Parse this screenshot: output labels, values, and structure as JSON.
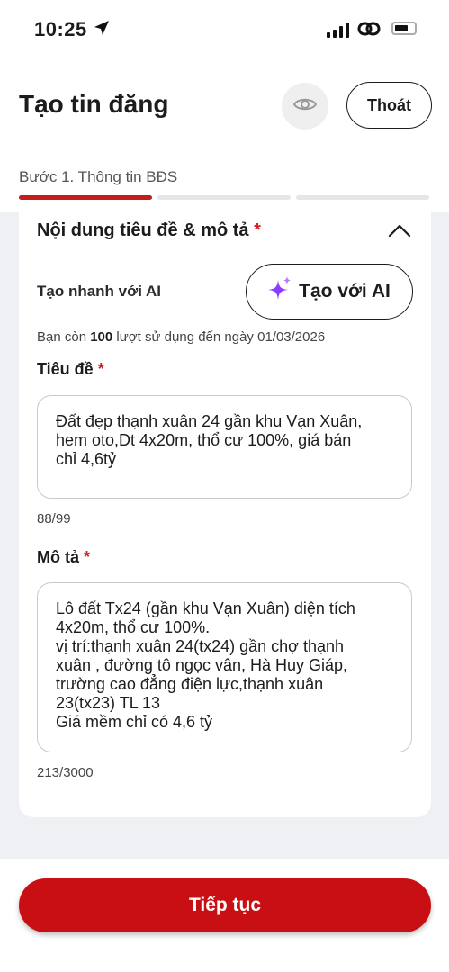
{
  "status_bar": {
    "time": "10:25"
  },
  "header": {
    "title": "Tạo tin đăng",
    "exit_label": "Thoát"
  },
  "stepper": {
    "label": "Bước 1. Thông tin BĐS",
    "total_steps": 3,
    "current_step": 1
  },
  "section": {
    "title": "Nội dung tiêu đề & mô tả",
    "required_mark": "*",
    "ai_label": "Tạo nhanh với AI",
    "ai_button": "Tạo với AI",
    "usage_prefix": "Bạn còn ",
    "usage_count": "100",
    "usage_suffix": " lượt sử dụng đến ngày 01/03/2026"
  },
  "title_field": {
    "label": "Tiêu đề",
    "value": "Đất đẹp thạnh xuân 24 gần khu Vạn Xuân,\nhem oto,Dt 4x20m, thổ cư 100%, giá bán\nchỉ 4,6tỷ",
    "counter": "88/99"
  },
  "description_field": {
    "label": "Mô tả",
    "value": "Lô đất Tx24 (gần khu Vạn Xuân) diện tích\n4x20m, thổ cư 100%.\nvị trí:thạnh xuân 24(tx24) gần chợ thạnh\nxuân , đường tô ngọc vân, Hà Huy Giáp,\ntrường cao đẳng điện lực,thạnh xuân\n23(tx23) TL 13\nGiá mềm chỉ có 4,6 tỷ",
    "counter": "213/3000"
  },
  "footer": {
    "continue_label": "Tiếp tục"
  },
  "colors": {
    "accent": "#c80f14",
    "required": "#d11d1d",
    "ai_sparkle": "#8b3dff"
  },
  "icons": [
    "location-arrow-icon",
    "signal-icon",
    "link-icon",
    "battery-icon",
    "eye-icon",
    "chevron-up-icon",
    "sparkle-icon"
  ]
}
